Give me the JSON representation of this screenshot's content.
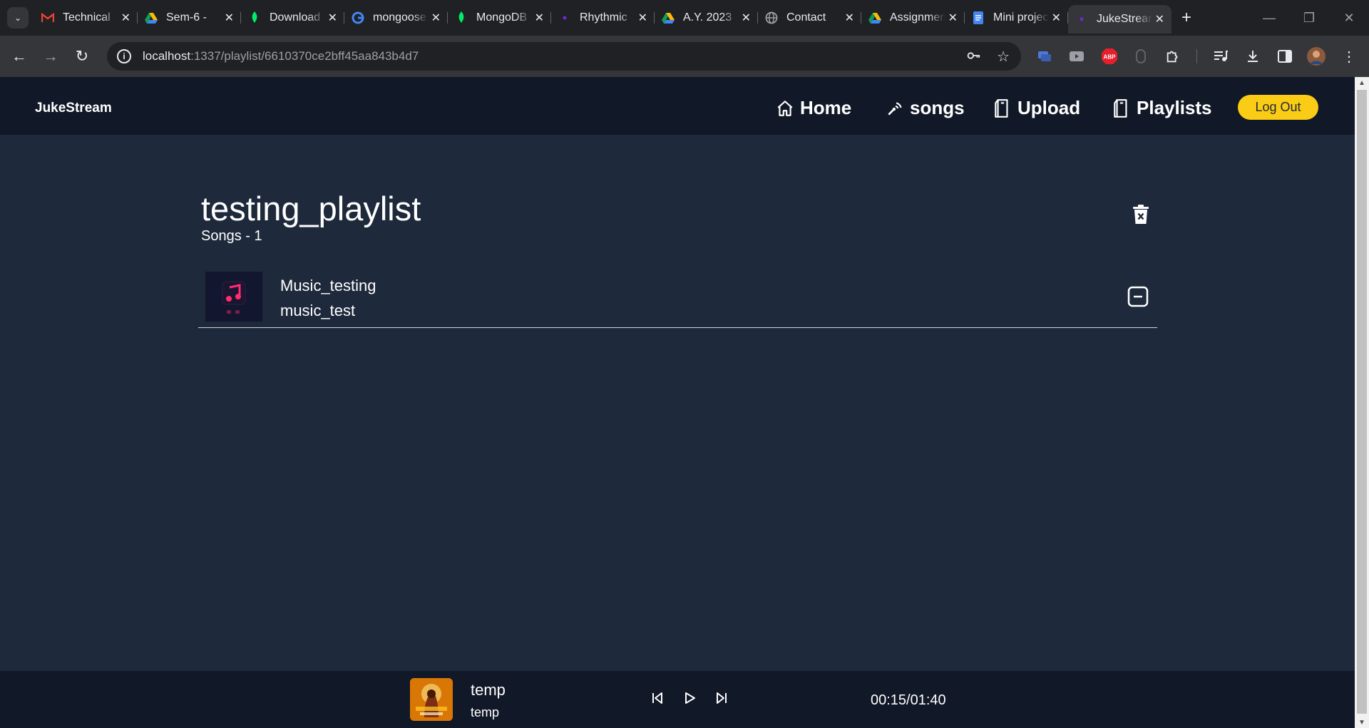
{
  "browser": {
    "tabs": [
      {
        "title": "Technical",
        "favicon": "gmail-icon",
        "color": "#ea4335",
        "active": false
      },
      {
        "title": "Sem-6 -",
        "favicon": "drive-icon",
        "color": "#fbbc04",
        "active": false
      },
      {
        "title": "Download",
        "favicon": "mongodb-leaf-icon",
        "color": "#00ed64",
        "active": false
      },
      {
        "title": "mongoose",
        "favicon": "google-icon",
        "color": "#4285f4",
        "active": false
      },
      {
        "title": "MongoDB",
        "favicon": "mongodb-leaf-icon",
        "color": "#00ed64",
        "active": false
      },
      {
        "title": "Rhythmic",
        "favicon": "dot-icon",
        "color": "#6d28d9",
        "active": false
      },
      {
        "title": "A.Y. 2023",
        "favicon": "drive-icon",
        "color": "#fbbc04",
        "active": false
      },
      {
        "title": "Contact",
        "favicon": "globe-icon",
        "color": "#9aa0a6",
        "active": false
      },
      {
        "title": "Assignment",
        "favicon": "drive-icon",
        "color": "#fbbc04",
        "active": false
      },
      {
        "title": "Mini project",
        "favicon": "docs-icon",
        "color": "#4285f4",
        "active": false
      },
      {
        "title": "JukeStream",
        "favicon": "dot-icon",
        "color": "#6d28d9",
        "active": true
      }
    ],
    "url_host": "localhost",
    "url_path": ":1337/playlist/6610370ce2bff45aa843b4d7",
    "extensions": [
      "screen-share-icon",
      "video-icon",
      "adblock-icon",
      "mouse-icon",
      "puzzle-icon",
      "media-icon",
      "download-icon",
      "sidepanel-icon",
      "avatar"
    ],
    "adblock_label": "ABP"
  },
  "app": {
    "brand": "JukeStream",
    "nav": {
      "home": "Home",
      "songs": "songs",
      "upload": "Upload",
      "playlists": "Playlists",
      "logout": "Log Out"
    }
  },
  "playlist": {
    "name": "testing_playlist",
    "count_label": "Songs - 1",
    "songs": [
      {
        "title": "Music_testing",
        "artist": "music_test"
      }
    ]
  },
  "player": {
    "title": "temp",
    "artist": "temp",
    "time": "00:15/01:40",
    "current_seconds": 15,
    "duration_seconds": 100
  },
  "colors": {
    "accent": "#facc15",
    "nav_bg": "#111827",
    "page_bg": "#1e293b"
  }
}
